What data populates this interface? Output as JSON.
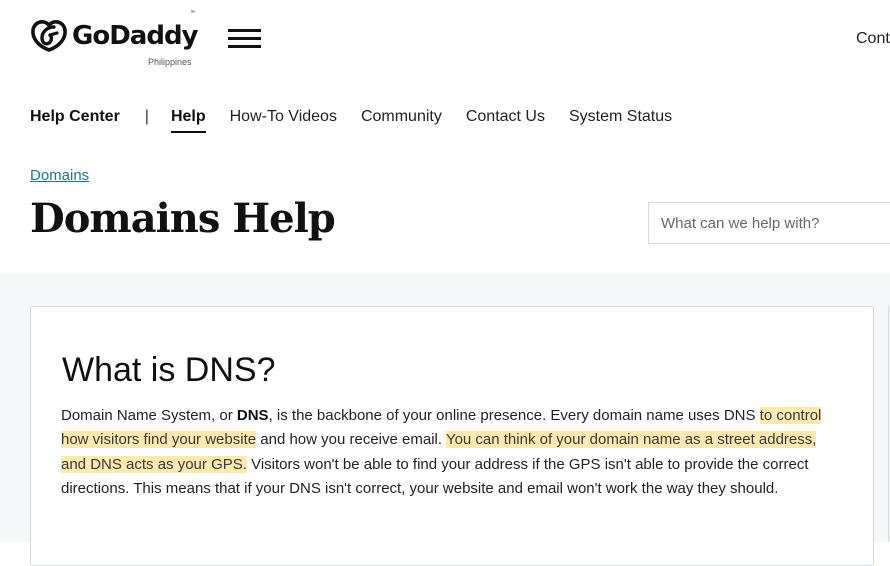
{
  "header": {
    "brand": "GoDaddy",
    "trademark": "™",
    "region": "Philippines",
    "menu_icon": "hamburger-icon",
    "logo_icon": "godaddy-heart-logo-icon",
    "right_link_partial": "Cont"
  },
  "subnav": {
    "brand": "Help Center",
    "separator": "|",
    "items": [
      {
        "label": "Help",
        "active": true
      },
      {
        "label": "How-To Videos",
        "active": false
      },
      {
        "label": "Community",
        "active": false
      },
      {
        "label": "Contact Us",
        "active": false
      },
      {
        "label": "System Status",
        "active": false
      }
    ]
  },
  "breadcrumb": "Domains",
  "page_title": "Domains Help",
  "search": {
    "placeholder": "What can we help with?",
    "value": ""
  },
  "article": {
    "title": "What is DNS?",
    "p_part1": "Domain Name System, or ",
    "p_bold": "DNS",
    "p_part2": ", is the backbone of your online presence. Every domain name uses DNS ",
    "p_highlight1": "to control how visitors find your website",
    "p_part3": " and how you receive email. ",
    "p_highlight2": "You can think of your domain name as a street address, and DNS acts as your GPS.",
    "p_part4": " Visitors won't be able to find your address if the GPS isn't able to provide the correct directions. This means that if your DNS isn't correct, your website and email won't work the way they should."
  },
  "colors": {
    "link": "#1b7a80",
    "highlight": "#fde9b0",
    "content_bg": "#f5f7f8",
    "border": "#d4dbe0"
  }
}
